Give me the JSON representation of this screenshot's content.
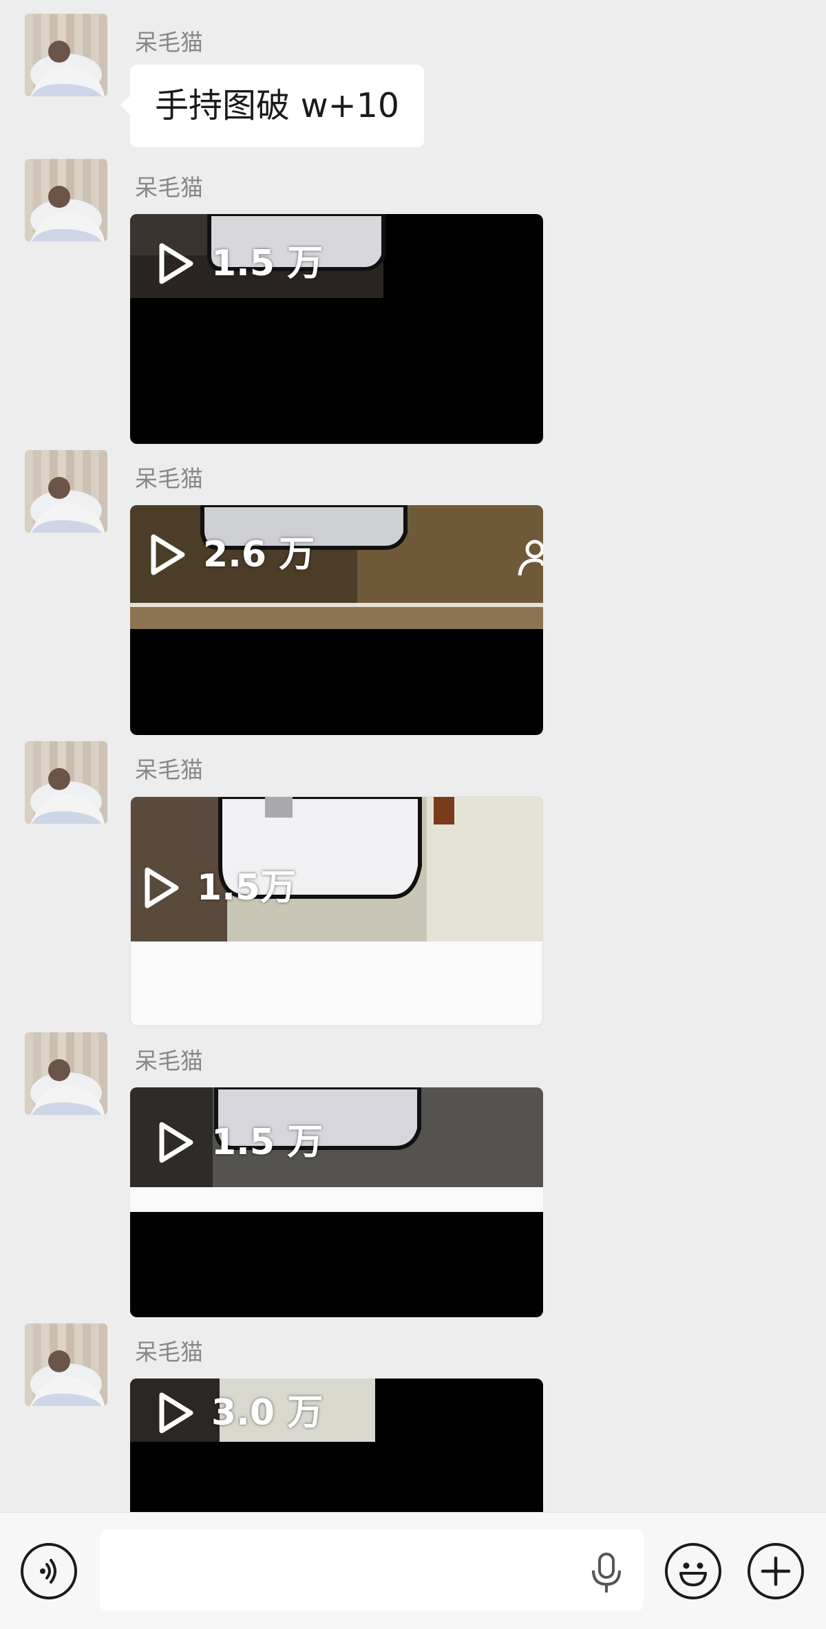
{
  "chat": {
    "messages": [
      {
        "sender": "呆毛猫",
        "type": "text",
        "text": "手持图破 w+10"
      },
      {
        "sender": "呆毛猫",
        "type": "video",
        "views": "1.5 万"
      },
      {
        "sender": "呆毛猫",
        "type": "video",
        "views": "2.6 万"
      },
      {
        "sender": "呆毛猫",
        "type": "video",
        "views": "1.5万"
      },
      {
        "sender": "呆毛猫",
        "type": "video",
        "views": "1.5 万"
      },
      {
        "sender": "呆毛猫",
        "type": "video",
        "views": "3.0 万"
      }
    ]
  },
  "icons": {
    "voice": "voice-mode-icon",
    "mic": "microphone-icon",
    "emoji": "emoji-icon",
    "plus": "more-plus-icon",
    "play": "play-icon",
    "avatar": "avatar-photo"
  },
  "input": {
    "value": ""
  },
  "colors": {
    "background": "#ededed",
    "bubble": "#ffffff",
    "sender_name": "#888888",
    "input_bar": "#f7f7f7"
  }
}
